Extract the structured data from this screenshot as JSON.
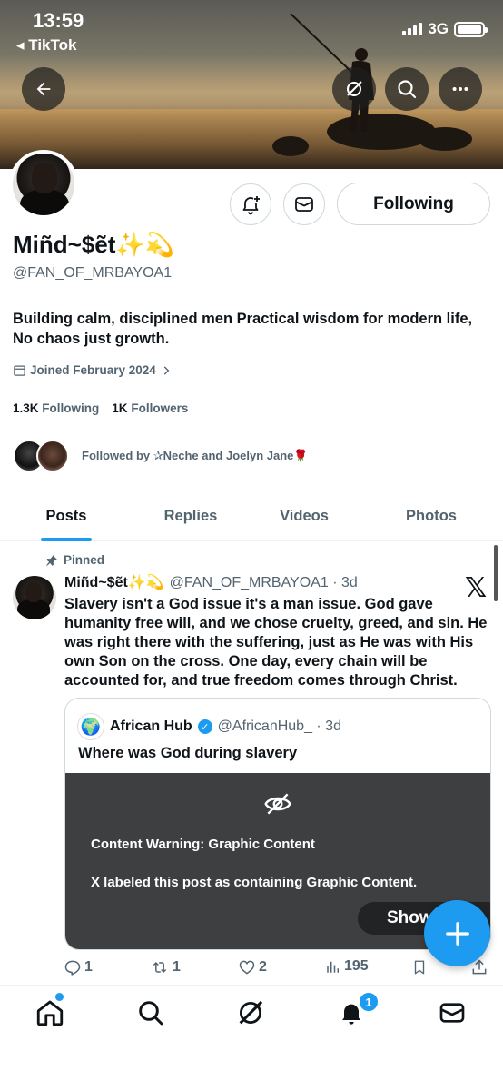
{
  "status_bar": {
    "time": "13:59",
    "back_app": "◂ TikTok",
    "network": "3G"
  },
  "profile": {
    "display_name": "Miñd~$ẽt✨💫",
    "handle": "@FAN_OF_MRBAYOA1",
    "bio": "Building calm, disciplined men Practical wisdom for modern life, No chaos just growth.",
    "joined": "Joined February 2024",
    "following_count": "1.3K",
    "following_label": "Following",
    "followers_count": "1K",
    "followers_label": "Followers",
    "followed_by": "Followed by ✰Neche and Joelyn Jane🌹",
    "follow_button": "Following"
  },
  "tabs": [
    "Posts",
    "Replies",
    "Videos",
    "Photos"
  ],
  "active_tab": "Posts",
  "pinned_post": {
    "pinned_label": "Pinned",
    "author_name": "Miñd~$ẽt✨💫",
    "author_handle": "@FAN_OF_MRBAYOA1 · 3d",
    "text": "Slavery isn't a God issue it's a man issue. God gave humanity free will, and we chose cruelty, greed, and sin. He was right there with the suffering, just as He was with His own Son on the cross. One day, every chain will be accounted for, and true freedom comes through Christ.",
    "quote": {
      "author_name": "African Hub",
      "author_handle": "@AfricanHub_ · 3d",
      "text": "Where was God during slavery",
      "warning_title": "Content Warning: Graphic Content",
      "warning_text": "X labeled this post as containing Graphic Content.",
      "show_button": "Show"
    },
    "metrics": {
      "replies": "1",
      "reposts": "1",
      "likes": "2",
      "views": "195"
    }
  },
  "bottom_nav": {
    "notification_badge": "1"
  },
  "colors": {
    "accent": "#1d9bf0",
    "text": "#0f1419",
    "muted": "#536471"
  }
}
